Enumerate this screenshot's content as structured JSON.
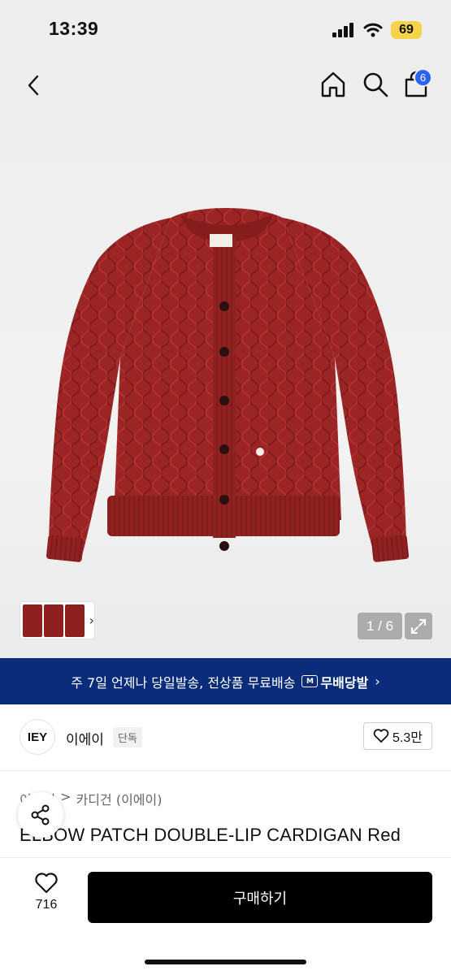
{
  "status_bar": {
    "time": "13:39",
    "battery": "69"
  },
  "nav": {
    "cart_count": "6"
  },
  "gallery": {
    "page_counter": "1 / 6"
  },
  "banner": {
    "text": "주 7일 언제나 당일발송, 전상품 무료배송",
    "badge_letter": "M",
    "badge_label": "무배당발",
    "chevron": "›"
  },
  "brand": {
    "logo_text": "IEY",
    "name": "이에이",
    "tag": "단독",
    "likes": "5.3만"
  },
  "breadcrumb": {
    "parent": "이에이",
    "separator": ">",
    "current": "카디건 (이에이)"
  },
  "product": {
    "title": "ELBOW PATCH DOUBLE-LIP CARDIGAN Red"
  },
  "bottom": {
    "wish_count": "716",
    "buy_label": "구매하기"
  },
  "colors": {
    "cardigan": "#9b2424",
    "banner": "#0b2c7a",
    "badge": "#2b63f5"
  }
}
